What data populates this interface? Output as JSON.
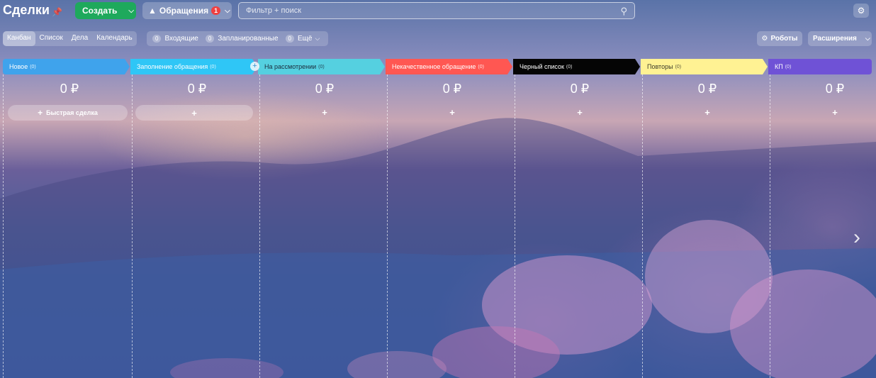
{
  "header": {
    "title": "Сделки",
    "create_label": "Создать",
    "requests_label": "Обращения",
    "requests_badge": "1",
    "search_placeholder": "Фильтр + поиск"
  },
  "views": [
    "Канбан",
    "Список",
    "Дела",
    "Календарь"
  ],
  "counters": [
    {
      "count": "0",
      "label": "Входящие"
    },
    {
      "count": "0",
      "label": "Запланированные"
    },
    {
      "count": "0",
      "label": "Ещё"
    }
  ],
  "right_buttons": {
    "robots": "Роботы",
    "extensions": "Расширения"
  },
  "quick_deal_label": "Быстрая сделка",
  "stages": [
    {
      "name": "Новое",
      "count": "(0)",
      "sum": "0 ₽",
      "color": "#3fa3ec",
      "text": "#ffffff"
    },
    {
      "name": "Заполнение обращения",
      "count": "(0)",
      "sum": "0 ₽",
      "color": "#2fc6f6",
      "text": "#ffffff"
    },
    {
      "name": "На рассмотрении",
      "count": "(0)",
      "sum": "0 ₽",
      "color": "#55d0e0",
      "text": "#1b2a3a"
    },
    {
      "name": "Некачественное обращение",
      "count": "(0)",
      "sum": "0 ₽",
      "color": "#ff5752",
      "text": "#ffffff"
    },
    {
      "name": "Черный список",
      "count": "(0)",
      "sum": "0 ₽",
      "color": "#050505",
      "text": "#ffffff"
    },
    {
      "name": "Повторы",
      "count": "(0)",
      "sum": "0 ₽",
      "color": "#fff293",
      "text": "#3a3a2a"
    },
    {
      "name": "КП",
      "count": "(0)",
      "sum": "0 ₽",
      "color": "#6f52d6",
      "text": "#ffffff"
    }
  ]
}
